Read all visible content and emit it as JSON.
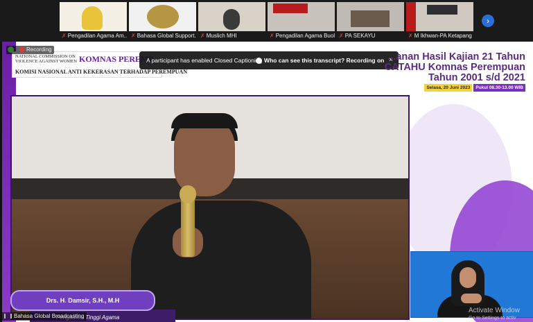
{
  "participants": [
    {
      "name": "Pengadilan Agama Am...",
      "thumb_color": "#f4f0e6",
      "accent": "#e9c33a"
    },
    {
      "name": "Bahasa Global Support...",
      "thumb_color": "#f1f1f1",
      "accent": "#b59643"
    },
    {
      "name": "Muslich MHI",
      "thumb_color": "#d9d2c9",
      "accent": "#3a3a3a"
    },
    {
      "name": "Pengadilan Agama Buol",
      "thumb_color": "#c9c3bd",
      "accent": "#b81c1c"
    },
    {
      "name": "PA SEKAYU",
      "thumb_color": "#bfbab3",
      "accent": "#6a5b4c"
    },
    {
      "name": "M Ikhwan-PA Ketapang",
      "thumb_color": "#cfc9c2",
      "accent": "#b81c1c"
    }
  ],
  "recording_label": "Recording",
  "toast": {
    "message": "A participant has enabled Closed Captioning",
    "who_link": "Who can see this transcript? Recording on",
    "close": "×"
  },
  "header": {
    "org_en": "NATIONAL COMMISSION ON VIOLENCE AGAINST WOMEN",
    "org_brand": "KOMNAS PEREMP",
    "org_id": "KOMISI NASIONAL ANTI KEKERASAN TERHADAP PEREMPUAN"
  },
  "event": {
    "title_line1": "...anan Hasil Kajian 21 Tahun",
    "title_line2": "CATAHU Komnas Perempuan",
    "title_line3": "Tahun 2001 s/d 2021",
    "date": "Selasa, 20 Juni 2023",
    "time": "Pukul 08.30-13.00 WIB"
  },
  "speaker": {
    "name": "Drs. H. Damsir, S.H., M.H",
    "affiliation": "Pengadilan Tinggi Agama"
  },
  "bottom_label": "Bahasa Global Broadcasting",
  "watermark": {
    "title": "Activate Window",
    "sub": "Go to Settings to activ"
  },
  "colors": {
    "brand_purple": "#6a1fa6",
    "mute_red": "#e53935",
    "nav_blue": "#2b6fd6",
    "signer_blue": "#2178d6"
  },
  "icons": {
    "next": "chevron-right-icon",
    "muted": "mic-off-icon",
    "shield": "shield-icon",
    "record": "record-dot-icon"
  }
}
